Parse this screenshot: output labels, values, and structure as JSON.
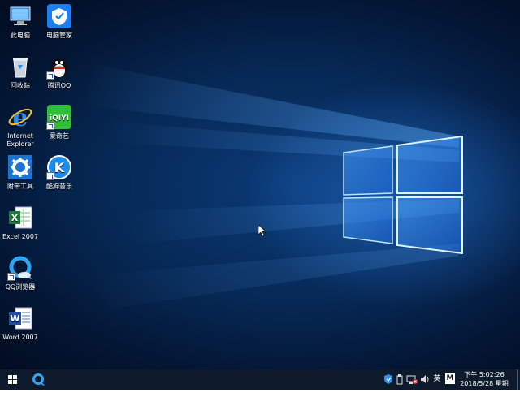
{
  "desktop": {
    "icons": [
      {
        "name": "此电脑",
        "icon": "computer-icon"
      },
      {
        "name": "电脑管家",
        "icon": "pc-manager-icon"
      },
      {
        "name": "回收站",
        "icon": "recycle-bin-icon"
      },
      {
        "name": "腾讯QQ",
        "icon": "qq-penguin-icon"
      },
      {
        "name": "Internet Explorer",
        "icon": "internet-explorer-icon"
      },
      {
        "name": "爱奇艺",
        "icon": "iqiyi-icon"
      },
      {
        "name": "附带工具",
        "icon": "tools-gear-icon"
      },
      {
        "name": "酷狗音乐",
        "icon": "kugou-music-icon"
      },
      {
        "name": "Excel 2007",
        "icon": "excel-icon"
      },
      {
        "name": "QQ浏览器",
        "icon": "qq-browser-icon"
      },
      {
        "name": "Word 2007",
        "icon": "word-icon"
      }
    ]
  },
  "taskbar": {
    "start_icon": "windows-start-icon",
    "pinned": [
      {
        "icon": "qq-browser-icon"
      }
    ],
    "tray": {
      "ime_label": "英",
      "ime_mode": "M",
      "time": "下午 5:02:26",
      "date": "2018/5/28 星期一"
    }
  },
  "colors": {
    "taskbar_bg": "#0d1a2c",
    "wallpaper_glow": "#3b9cff"
  }
}
